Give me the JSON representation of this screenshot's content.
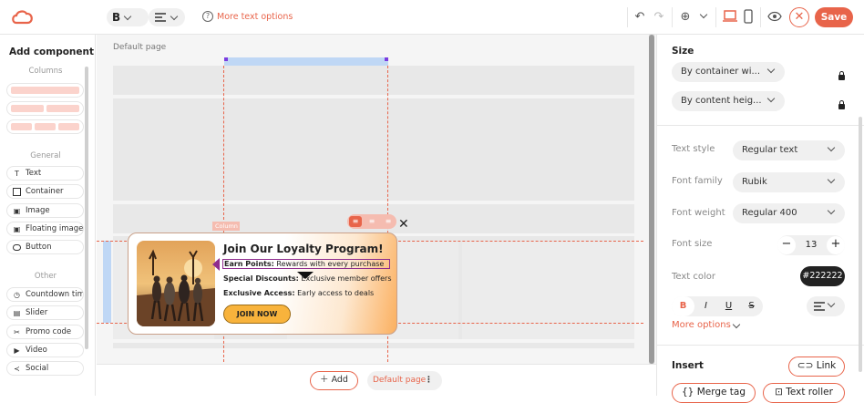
{
  "topbar": {
    "bold_label": "B",
    "more_text_options": "More text options",
    "save_label": "Save"
  },
  "left_panel": {
    "title": "Add component",
    "section_columns": "Columns",
    "section_general": "General",
    "section_other": "Other",
    "general_items": [
      "Text",
      "Container",
      "Image",
      "Floating image",
      "Button"
    ],
    "other_items": [
      "Countdown timer",
      "Slider",
      "Promo code",
      "Video",
      "Social"
    ]
  },
  "canvas": {
    "page_label": "Default page",
    "column_tag": "Column",
    "popup": {
      "title": "Join Our Loyalty Program!",
      "line1_bold": "Earn Points:",
      "line1_text": "Rewards with every purchase",
      "line2_bold": "Special Discounts:",
      "line2_text": "Exclusive member offers",
      "line3_bold": "Exclusive Access:",
      "line3_text": "Early access to deals",
      "button_label": "JOIN NOW"
    }
  },
  "bottom_bar": {
    "add_label": "Add",
    "page_selector": "Default page"
  },
  "right_panel": {
    "size_title": "Size",
    "width_select": "By container wi...",
    "height_select": "By content heig...",
    "text_style_label": "Text style",
    "text_style_value": "Regular text",
    "font_family_label": "Font family",
    "font_family_value": "Rubik",
    "font_weight_label": "Font weight",
    "font_weight_value": "Regular 400",
    "font_size_label": "Font size",
    "font_size_value": "13",
    "text_color_label": "Text color",
    "text_color_value": "#222222",
    "format_bold": "B",
    "format_italic": "I",
    "format_underline": "U",
    "format_strike": "S",
    "more_options": "More options",
    "insert_title": "Insert",
    "link_label": "Link",
    "merge_tag_label": "Merge tag",
    "text_roller_label": "Text roller"
  },
  "colors": {
    "accent": "#e8644a",
    "button_fill": "#f8b33c"
  }
}
